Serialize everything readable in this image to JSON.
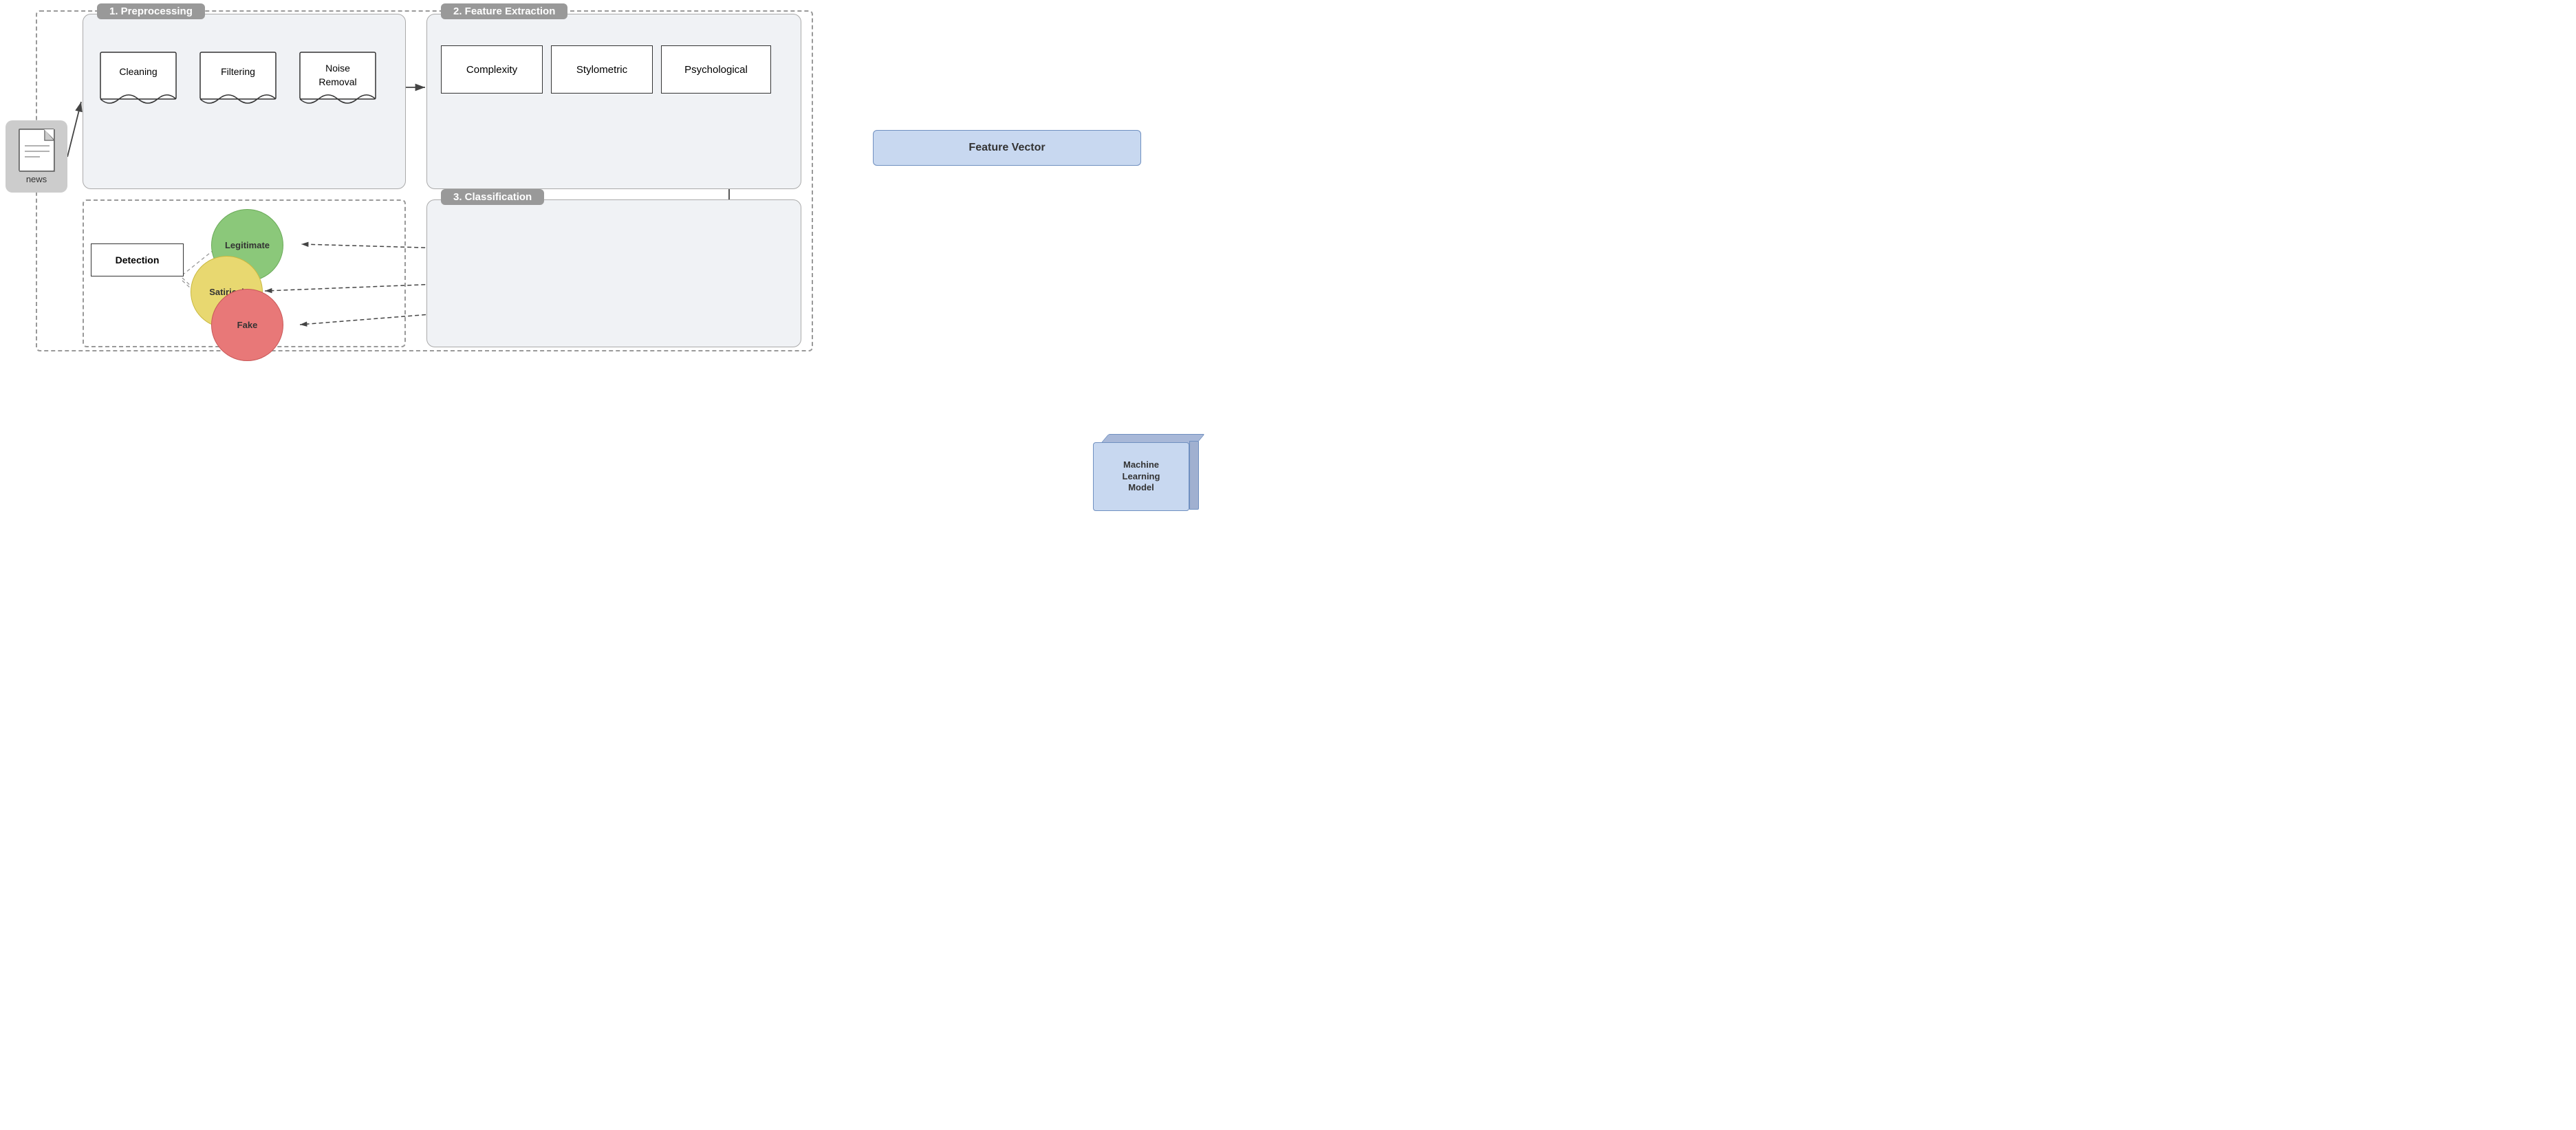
{
  "labels": {
    "preprocessing": "1. Preprocessing",
    "feature_extraction": "2. Feature Extraction",
    "classification": "3. Classification",
    "cleaning": "Cleaning",
    "filtering": "Filtering",
    "noise_removal": "Noise\nRemoval",
    "complexity": "Complexity",
    "stylometric": "Stylometric",
    "psychological": "Psychological",
    "feature_vector": "Feature Vector",
    "detection": "Detection",
    "legitimate": "Legitimate",
    "satirical": "Satirical",
    "fake": "Fake",
    "ml_model": "Machine\nLearning\nModel",
    "news": "news"
  },
  "colors": {
    "box_bg": "#f0f2f5",
    "box_border": "#aaa",
    "label_bg": "#888",
    "feature_vector_bg": "#c8d8f0",
    "ml_model_bg": "#c8d8f0",
    "legitimate_bg": "#8bc87a",
    "satirical_bg": "#e8d870",
    "fake_bg": "#e87878",
    "arrow": "#444",
    "dashed": "#999"
  }
}
